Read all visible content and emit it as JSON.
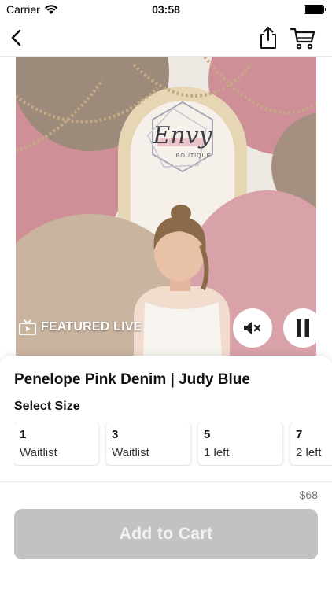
{
  "status_bar": {
    "carrier": "Carrier",
    "time": "03:58"
  },
  "nav": {
    "icons": [
      "chevron-left-icon",
      "share-icon",
      "shopping-cart-icon"
    ]
  },
  "video": {
    "overlay_label": "FEATURED LIVE",
    "sign_text": "Envy",
    "sign_subtext": "BOUTIQUE",
    "icons": [
      "tv-icon",
      "speaker-muted-icon",
      "pause-icon"
    ]
  },
  "product": {
    "title": "Penelope Pink Denim | Judy Blue",
    "select_size_label": "Select Size",
    "sizes": [
      {
        "size": "1",
        "status": "Waitlist"
      },
      {
        "size": "3",
        "status": "Waitlist"
      },
      {
        "size": "5",
        "status": "1 left"
      },
      {
        "size": "7",
        "status": "2 left"
      }
    ]
  },
  "footer": {
    "price": "$68",
    "add_to_cart_label": "Add to Cart"
  },
  "colors": {
    "button_disabled": "#c2c2c2",
    "backdrop_pink": "#cf8f97",
    "backdrop_taupe": "#9c8a7a"
  }
}
